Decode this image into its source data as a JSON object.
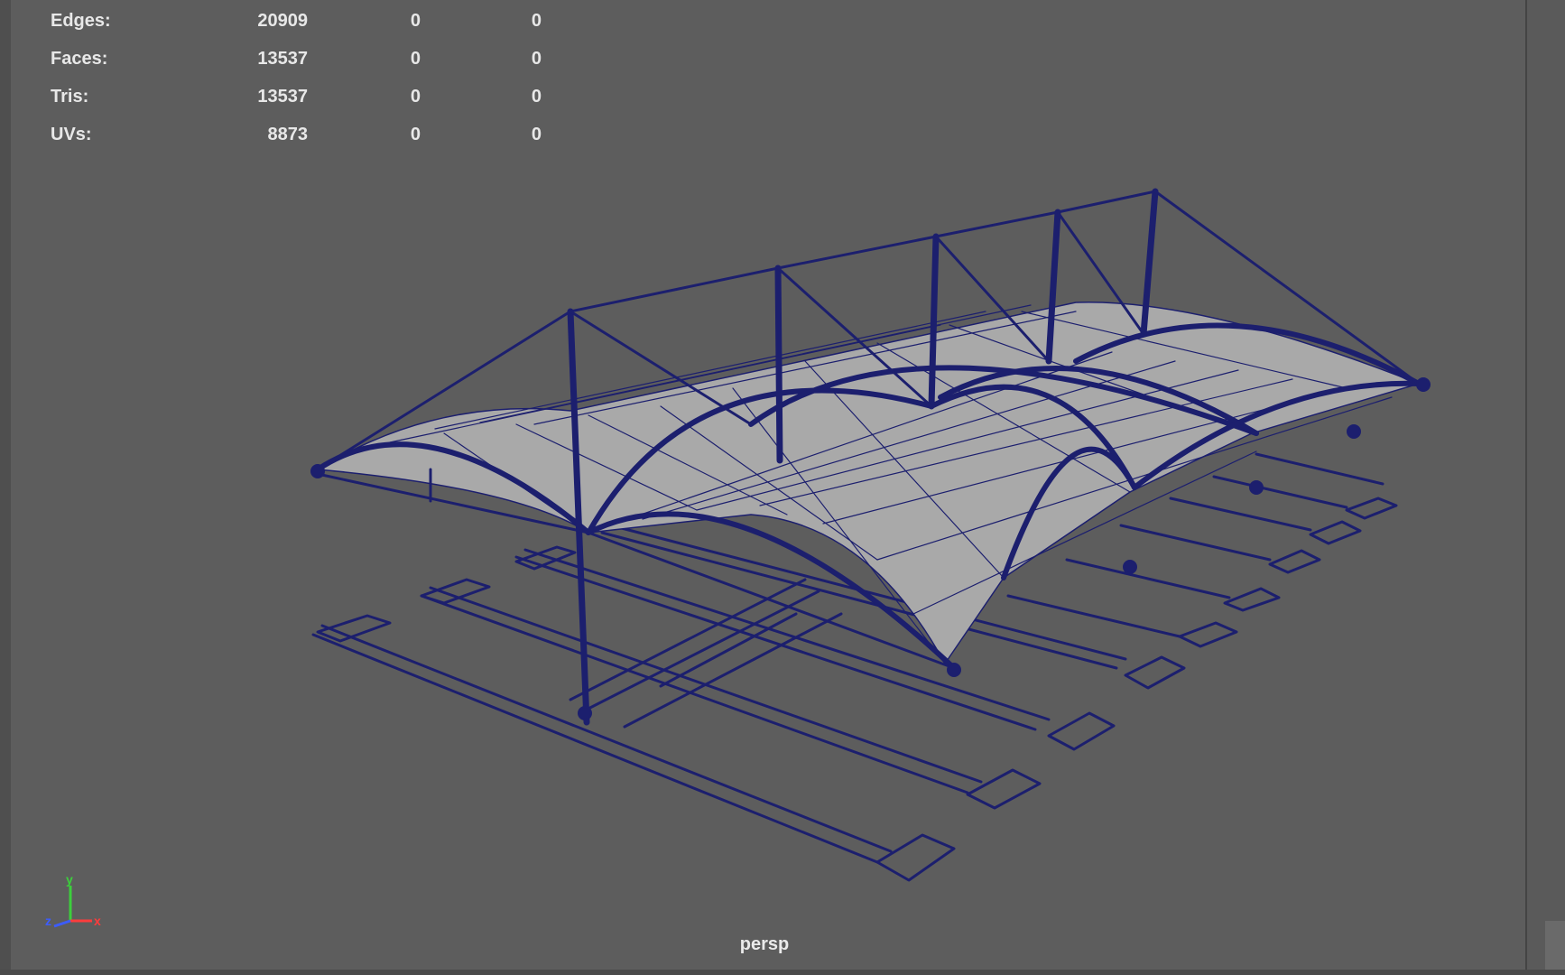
{
  "stats": [
    {
      "label": "Edges:",
      "v1": "20909",
      "v2": "0",
      "v3": "0"
    },
    {
      "label": "Faces:",
      "v1": "13537",
      "v2": "0",
      "v3": "0"
    },
    {
      "label": "Tris:",
      "v1": "13537",
      "v2": "0",
      "v3": "0"
    },
    {
      "label": "UVs:",
      "v1": "8873",
      "v2": "0",
      "v3": "0"
    }
  ],
  "viewport": {
    "camera": "persp",
    "background_color": "#5d5d5d",
    "wireframe_color": "#1c1f6e"
  },
  "axis_gizmo": {
    "y_label": "y",
    "z_label": "z",
    "x_label": "x",
    "y_color": "#3ccf3c",
    "z_color": "#3c5cff",
    "x_color": "#ff3c3c"
  }
}
